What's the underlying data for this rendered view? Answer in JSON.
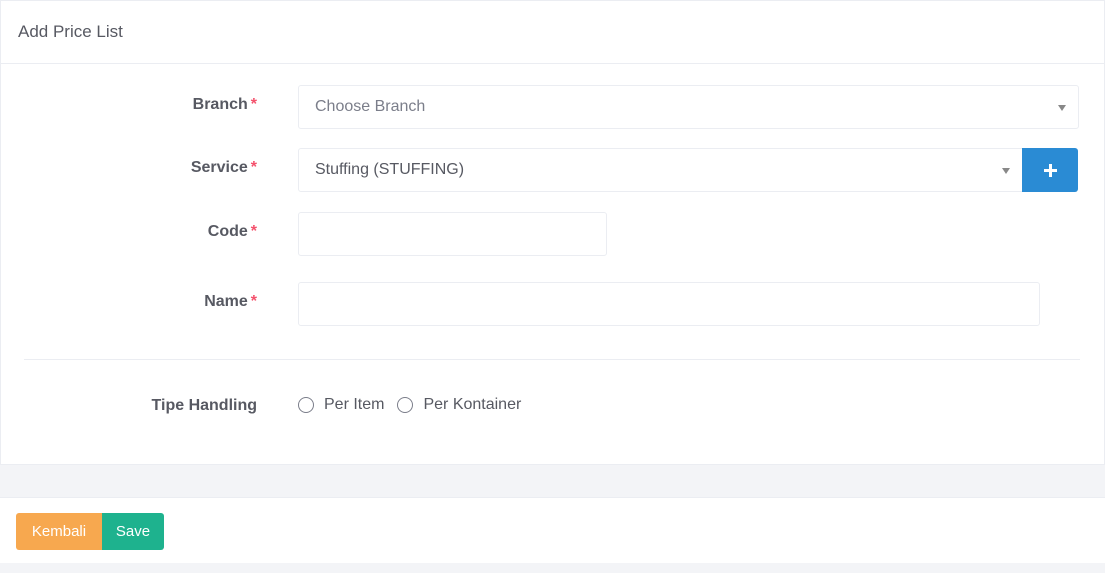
{
  "header": {
    "title": "Add Price List"
  },
  "form": {
    "branch": {
      "label": "Branch",
      "required_mark": "*",
      "placeholder": "Choose Branch"
    },
    "service": {
      "label": "Service",
      "required_mark": "*",
      "value": "Stuffing (STUFFING)"
    },
    "code": {
      "label": "Code",
      "required_mark": "*",
      "value": ""
    },
    "name": {
      "label": "Name",
      "required_mark": "*",
      "value": ""
    },
    "tipe_handling": {
      "label": "Tipe Handling",
      "options": [
        {
          "label": "Per Item",
          "selected": false
        },
        {
          "label": "Per Kontainer",
          "selected": false
        }
      ]
    }
  },
  "footer": {
    "back_label": "Kembali",
    "save_label": "Save"
  },
  "colors": {
    "primary": "#2a8bd4",
    "warning": "#f7a84f",
    "success": "#1eb28e",
    "required": "#f4516c"
  }
}
